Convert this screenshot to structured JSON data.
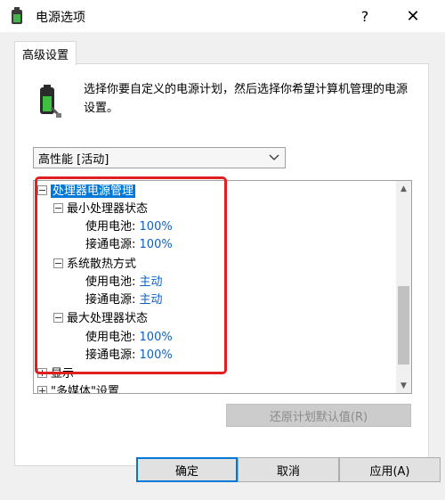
{
  "window": {
    "title": "电源选项",
    "help_glyph": "?",
    "close_glyph": "✕"
  },
  "tab": {
    "label": "高级设置"
  },
  "description": "选择你要自定义的电源计划，然后选择你希望计算机管理的电源设置。",
  "plan_select": {
    "value": "高性能 [活动]"
  },
  "tree": {
    "items": [
      {
        "label": "处理器电源管理",
        "expander": "minus",
        "selected": true
      },
      {
        "label": "最小处理器状态",
        "expander": "minus"
      },
      {
        "prefix": "使用电池:",
        "value": "100%"
      },
      {
        "prefix": "接通电源:",
        "value": "100%"
      },
      {
        "label": "系统散热方式",
        "expander": "minus"
      },
      {
        "prefix": "使用电池:",
        "value": "主动"
      },
      {
        "prefix": "接通电源:",
        "value": "主动"
      },
      {
        "label": "最大处理器状态",
        "expander": "minus"
      },
      {
        "prefix": "使用电池:",
        "value": "100%"
      },
      {
        "prefix": "接通电源:",
        "value": "100%"
      },
      {
        "label": "显示",
        "expander": "plus"
      },
      {
        "label": "\"多媒体\"设置",
        "expander": "plus"
      }
    ]
  },
  "restore_button": {
    "label": "还原计划默认值(R)"
  },
  "buttons": {
    "ok": "确定",
    "cancel": "取消",
    "apply": "应用(A)"
  },
  "icons": {
    "app": "power-options-icon",
    "battery": "battery-plug-icon"
  },
  "colors": {
    "selection": "#0078d7",
    "value_text": "#0a62c8",
    "annotation": "#e02020"
  }
}
